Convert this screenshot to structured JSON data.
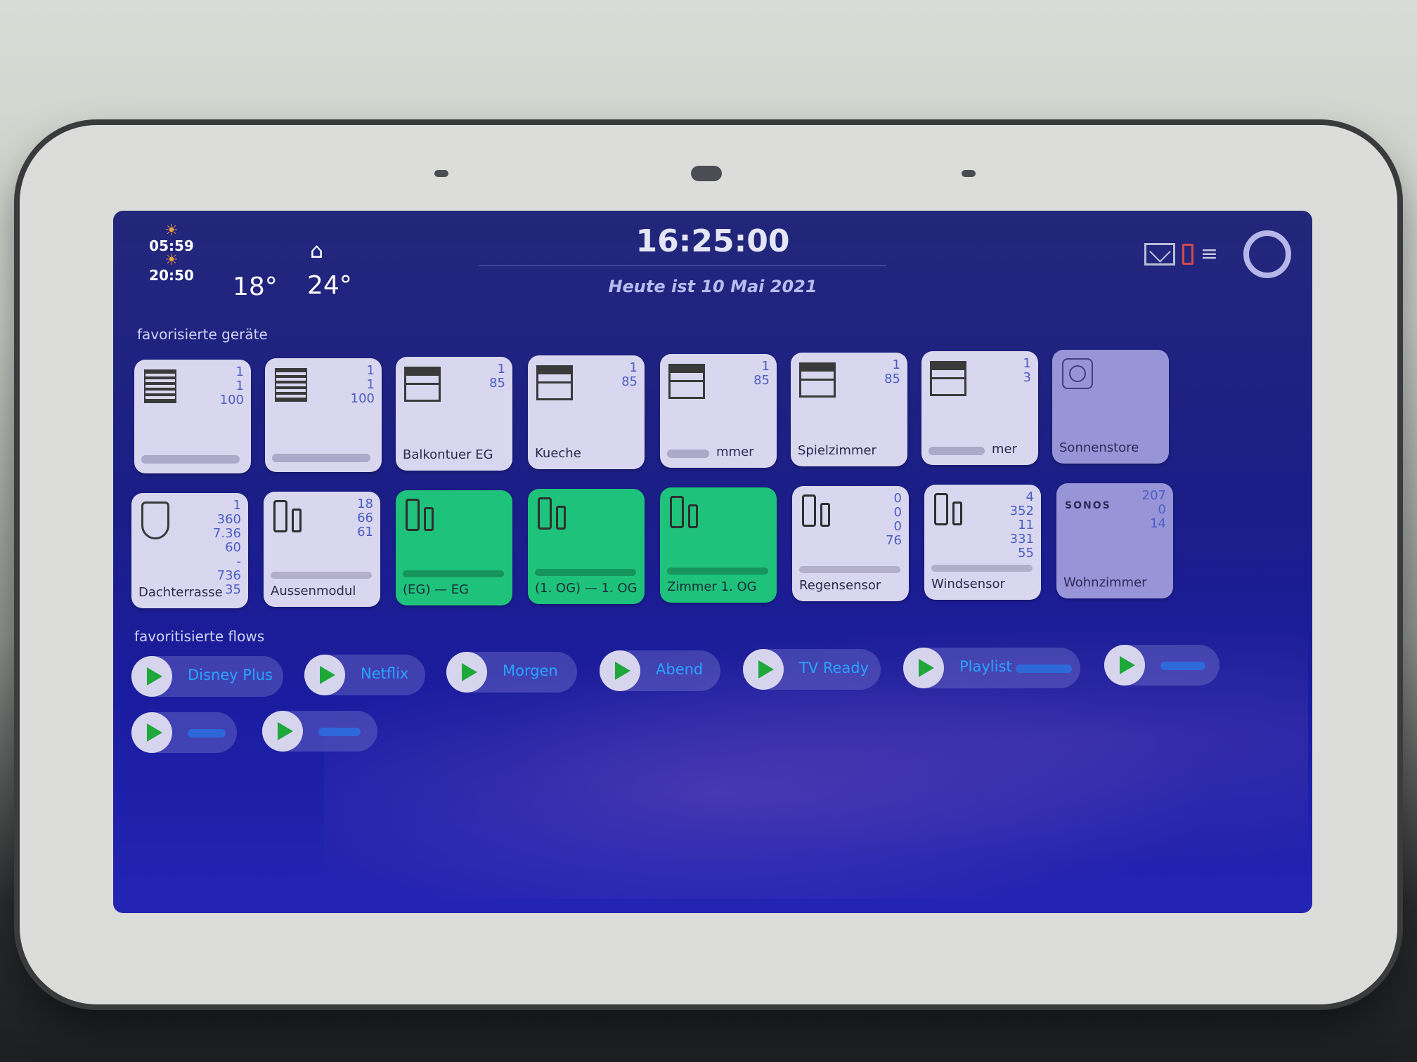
{
  "header": {
    "sunrise": "05:59",
    "sunset": "20:50",
    "temp_outside": "18°",
    "temp_house": "24°",
    "clock": "16:25:00",
    "date": "Heute ist 10 Mai 2021"
  },
  "sections": {
    "devices": "favorisierte geräte",
    "flows": "favoritisierte flows"
  },
  "devices_row1": [
    {
      "name": "",
      "vals": [
        "1",
        "1",
        "100"
      ],
      "icon": "blinds-icon"
    },
    {
      "name": "",
      "vals": [
        "1",
        "1",
        "100"
      ],
      "icon": "blinds-icon"
    },
    {
      "name": "Balkontuer EG",
      "vals": [
        "1",
        "85"
      ],
      "icon": "shutter-icon"
    },
    {
      "name": "Kueche",
      "vals": [
        "1",
        "85"
      ],
      "icon": "shutter-icon"
    },
    {
      "name": "mmer",
      "vals": [
        "1",
        "85"
      ],
      "icon": "shutter-icon"
    },
    {
      "name": "Spielzimmer",
      "vals": [
        "1",
        "85"
      ],
      "icon": "shutter-icon"
    },
    {
      "name": "mer",
      "vals": [
        "1",
        "3"
      ],
      "icon": "shutter-icon"
    },
    {
      "name": "Sonnenstore",
      "vals": [],
      "icon": "socket-icon"
    }
  ],
  "devices_row2": [
    {
      "name": "Dachterrasse",
      "vals": [
        "1",
        "360",
        "7.36",
        "60",
        "-",
        "736",
        "35"
      ],
      "icon": "motion-sensor-icon"
    },
    {
      "name": "Aussenmodul",
      "vals": [
        "18",
        "66",
        "61"
      ],
      "icon": "weather-station-icon"
    },
    {
      "name": "(EG) — EG",
      "vals": [],
      "icon": "weather-station-icon"
    },
    {
      "name": "(1. OG) — 1. OG",
      "vals": [],
      "icon": "weather-station-icon"
    },
    {
      "name": "Zimmer 1. OG",
      "vals": [],
      "icon": "weather-station-icon"
    },
    {
      "name": "Regensensor",
      "vals": [
        "0",
        "0",
        "0",
        "76"
      ],
      "icon": "weather-station-icon"
    },
    {
      "name": "Windsensor",
      "vals": [
        "4",
        "352",
        "11",
        "331",
        "55"
      ],
      "icon": "weather-station-icon"
    },
    {
      "name": "Wohnzimmer",
      "vals": [
        "207",
        "0",
        "14"
      ],
      "icon": "sonos-logo",
      "brand": "SONOS"
    }
  ],
  "flows": [
    {
      "label": "Disney Plus"
    },
    {
      "label": "Netflix"
    },
    {
      "label": "Morgen"
    },
    {
      "label": "Abend"
    },
    {
      "label": "TV Ready"
    },
    {
      "label": "Playlist"
    },
    {
      "label": ""
    },
    {
      "label": ""
    },
    {
      "label": ""
    }
  ],
  "colors": {
    "screen_bg": "#1b1e86",
    "tile": "#d9d6f0",
    "tile_active": "#1ec27a",
    "flow_text": "#2aa3ff",
    "play_icon": "#1ea83a"
  }
}
